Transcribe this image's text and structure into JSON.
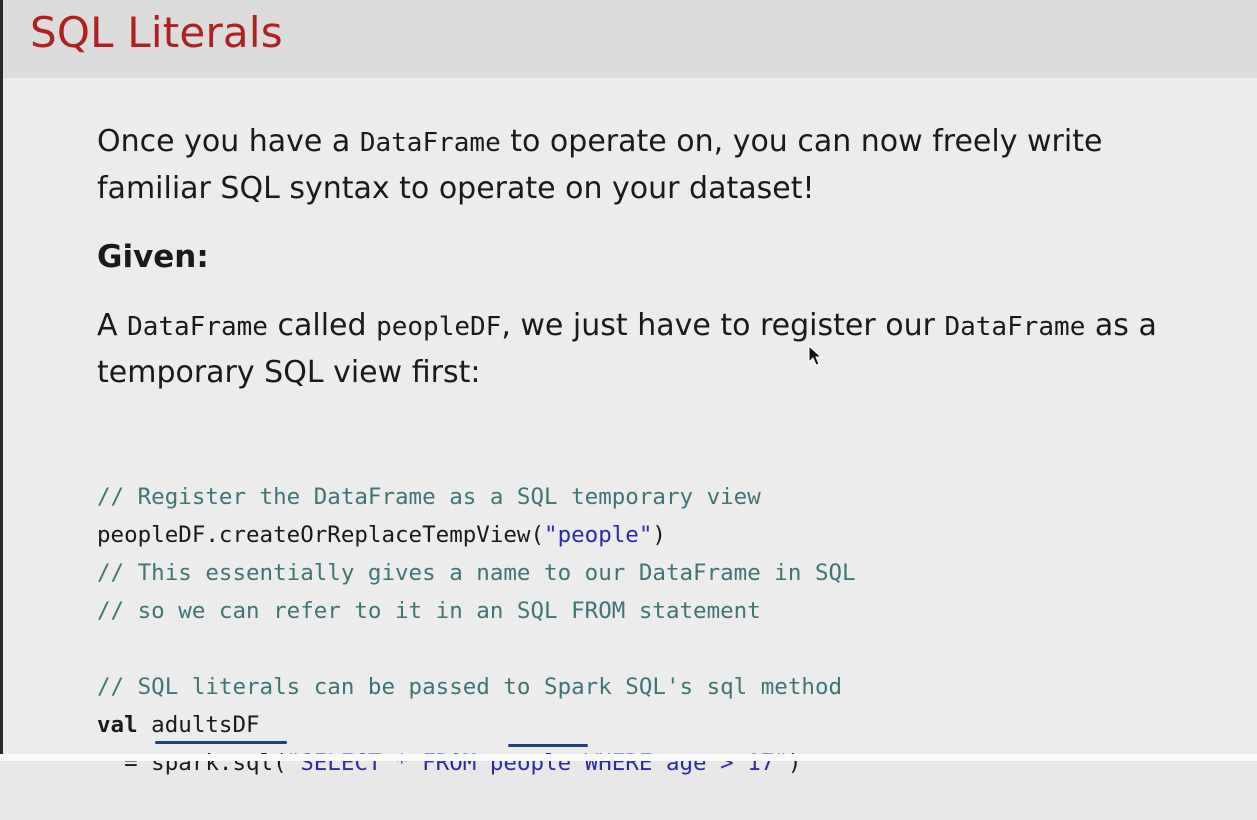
{
  "slide": {
    "title": "SQL Literals",
    "intro": {
      "p1": "Once you have a ",
      "m1": "DataFrame",
      "p2": " to operate on, you can now freely write",
      "line2": "familiar SQL syntax to operate on your dataset!"
    },
    "given_label": "Given:",
    "given_text": {
      "p1": "A ",
      "m1": "DataFrame",
      "p2": " called ",
      "m2": "peopleDF",
      "p3": ", we just have to register our ",
      "m3": "DataFrame",
      "p4": " as a",
      "line2": "temporary SQL view first:"
    },
    "code": {
      "c1": "// Register the DataFrame as a SQL temporary view",
      "l2_code": "peopleDF.createOrReplaceTempView(",
      "l2_str": "\"people\"",
      "l2_end": ")",
      "c3": "// This essentially gives a name to our DataFrame in SQL",
      "c4": "// so we can refer to it in an SQL FROM statement",
      "c6": "// SQL literals can be passed to Spark SQL's sql method",
      "l7_kw": "val",
      "l7_rest": " adultsDF",
      "l8_pre": "  = spark.sql(",
      "l8_str": "\"SELECT * FROM people WHERE age > 17\"",
      "l8_end": ")"
    }
  },
  "colors": {
    "title": "#b21f1f",
    "comment": "#3f7575",
    "string": "#2b2ba8",
    "annotation": "#1d3e86"
  },
  "icons": {
    "cursor": "mouse-pointer-icon"
  }
}
